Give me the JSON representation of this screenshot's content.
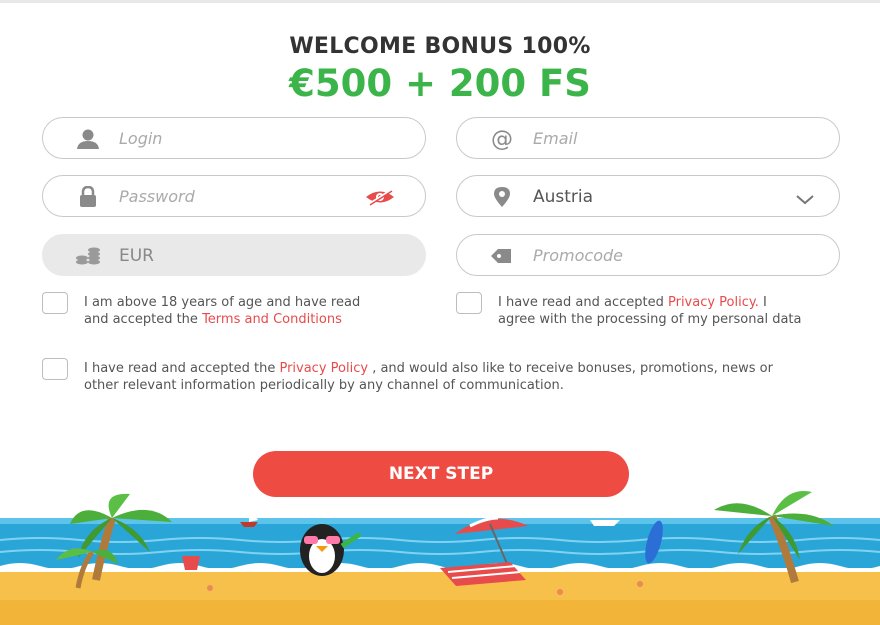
{
  "header": {
    "title": "WELCOME BONUS 100%",
    "bonus": "€500 + 200 FS"
  },
  "form": {
    "login": {
      "placeholder": "Login",
      "icon": "user-icon"
    },
    "email": {
      "placeholder": "Email",
      "icon": "at-icon"
    },
    "password": {
      "placeholder": "Password",
      "icon": "lock-icon",
      "toggle_icon": "eye-hidden-icon"
    },
    "country": {
      "value": "Austria",
      "icon": "location-pin-icon",
      "dropdown_icon": "chevron-down-icon"
    },
    "currency": {
      "value": "EUR",
      "icon": "coins-icon"
    },
    "promocode": {
      "placeholder": "Promocode",
      "icon": "tag-icon"
    }
  },
  "checkboxes": {
    "age": {
      "text_before": "I am above 18 years of age and have read and accepted the ",
      "link": "Terms and Conditions",
      "text_after": ""
    },
    "privacy": {
      "text_before": "I have read and accepted ",
      "link": "Privacy Policy.",
      "text_after": " I agree with the processing of my personal data"
    },
    "marketing": {
      "text_before": "I have read and accepted the ",
      "link": "Privacy Policy",
      "text_after": " , and would also like to receive bonuses, promotions, news or other relevant information periodically by any channel of communication."
    }
  },
  "actions": {
    "next_label": "NEXT STEP"
  },
  "colors": {
    "accent_green": "#3bb54a",
    "button_red": "#ee4b43",
    "link_red": "#e84b4b"
  }
}
